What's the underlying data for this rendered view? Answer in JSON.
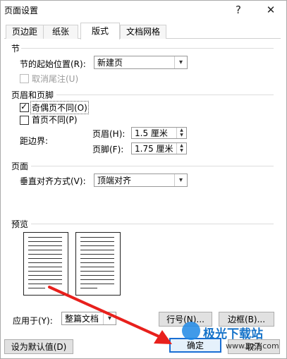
{
  "window": {
    "title": "页面设置"
  },
  "titlebar": {
    "help": "?",
    "close": "✕"
  },
  "tabs": [
    {
      "label": "页边距"
    },
    {
      "label": "纸张"
    },
    {
      "label": "版式"
    },
    {
      "label": "文档网格"
    }
  ],
  "section": {
    "title": "节",
    "start_label": "节的起始位置(R):",
    "start_value": "新建页",
    "suppress_endnotes_label": "取消尾注(U)"
  },
  "header_footer": {
    "title": "页眉和页脚",
    "odd_even_label": "奇偶页不同(O)",
    "first_page_label": "首页不同(P)",
    "from_edge_label": "距边界:",
    "header_label": "页眉(H):",
    "header_value": "1.5 厘米",
    "footer_label": "页脚(F):",
    "footer_value": "1.75 厘米"
  },
  "page": {
    "title": "页面",
    "valign_label": "垂直对齐方式(V):",
    "valign_value": "顶端对齐"
  },
  "preview": {
    "title": "预览",
    "apply_label": "应用于(Y):",
    "apply_value": "整篇文档",
    "line_numbers_button": "行号(N)...",
    "borders_button": "边框(B)..."
  },
  "footer_buttons": {
    "default": "设为默认值(D)",
    "ok": "确定",
    "cancel": "取消"
  },
  "watermark": {
    "name": "极光下载站",
    "url": "www.xz7.com"
  }
}
